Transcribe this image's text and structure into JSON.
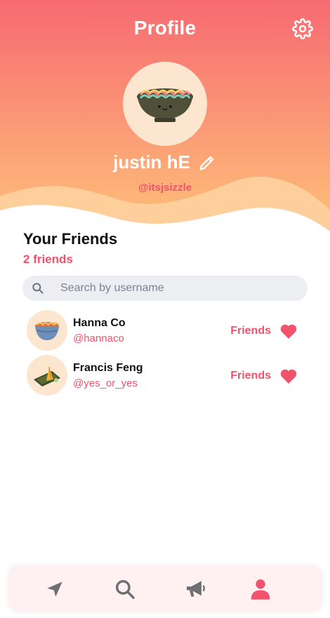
{
  "header": {
    "title": "Profile",
    "gradient_top": "#f76a72",
    "gradient_bottom": "#fdb978"
  },
  "profile": {
    "name": "justin hE",
    "handle": "@itsjsizzle",
    "avatar_icon": "ramen-bowl-icon"
  },
  "friends_section": {
    "title": "Your Friends",
    "count_label": "2 friends"
  },
  "search": {
    "placeholder": "Search by username",
    "value": ""
  },
  "friends": [
    {
      "name": "Hanna Co",
      "handle": "@hannaco",
      "status": "Friends",
      "avatar_icon": "bowl-icon"
    },
    {
      "name": "Francis Feng",
      "handle": "@yes_or_yes",
      "status": "Friends",
      "avatar_icon": "dumpling-icon"
    }
  ],
  "nav": {
    "items": [
      {
        "icon": "navigation-arrow-icon",
        "active": false
      },
      {
        "icon": "search-icon",
        "active": false
      },
      {
        "icon": "megaphone-icon",
        "active": false
      },
      {
        "icon": "user-icon",
        "active": true
      }
    ],
    "active_color": "#f0536b",
    "inactive_color": "#6e6e73"
  },
  "accent_color": "#f0536b"
}
